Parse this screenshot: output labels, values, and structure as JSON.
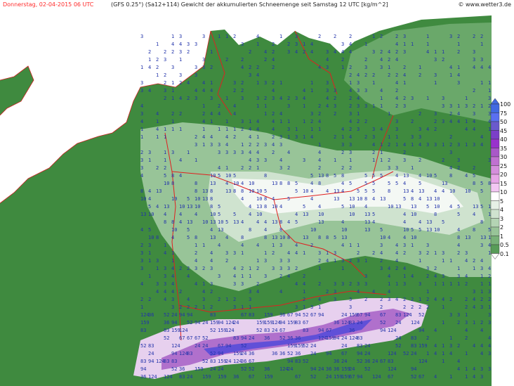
{
  "header": {
    "date": "Donnerstag, 02-04-2015  06 UTC",
    "model_info": "(GFS 0.25°) (Sa12+114)  Gewicht der akkumulierten Schneemenge seit Samstag 12 UTC [kg/m^2]",
    "copyright": "© www.wetter3.de"
  },
  "legend": {
    "values": [
      "100",
      "75",
      "50",
      "45",
      "40",
      "35",
      "30",
      "25",
      "20",
      "15",
      "10",
      "5",
      "4",
      "3",
      "2",
      "1",
      "0.5",
      "0.1"
    ],
    "colors": [
      "#4169e1",
      "#5a6ff0",
      "#6a5acd",
      "#7b3fc8",
      "#9932cc",
      "#a958c8",
      "#c071d0",
      "#d58fdc",
      "#e7a6e7",
      "#f3c7f3",
      "#ffffff",
      "#e6f0e6",
      "#cfe3cf",
      "#b4d4b4",
      "#98c498",
      "#78b178",
      "#589c58",
      "#3f8a3f"
    ]
  },
  "map": {
    "water_color": "#ffffff",
    "land_base_color": "#3f8a3f",
    "border_color": "#e02020",
    "coast_color": "#cc2222",
    "labels_sample": [
      {
        "t": "1",
        "c": "#2233aa"
      },
      {
        "t": "2",
        "c": "#2233aa"
      },
      {
        "t": "3",
        "c": "#2233aa"
      },
      {
        "t": "4",
        "c": "#2233aa"
      },
      {
        "t": "5",
        "c": "#2233aa"
      },
      {
        "t": "8",
        "c": "#2233aa"
      },
      {
        "t": "10",
        "c": "#2233aa"
      },
      {
        "t": "13",
        "c": "#2233aa"
      },
      {
        "t": "17",
        "c": "#2233aa"
      },
      {
        "t": "24",
        "c": "#ffffff"
      },
      {
        "t": "36",
        "c": "#ffffff"
      },
      {
        "t": "52",
        "c": "#ffffff"
      },
      {
        "t": "67",
        "c": "#ffffff"
      },
      {
        "t": "83",
        "c": "#ffffff"
      },
      {
        "t": "94",
        "c": "#ffffff"
      },
      {
        "t": "124",
        "c": "#ffffff"
      },
      {
        "t": "159",
        "c": "#ffffff"
      }
    ]
  }
}
